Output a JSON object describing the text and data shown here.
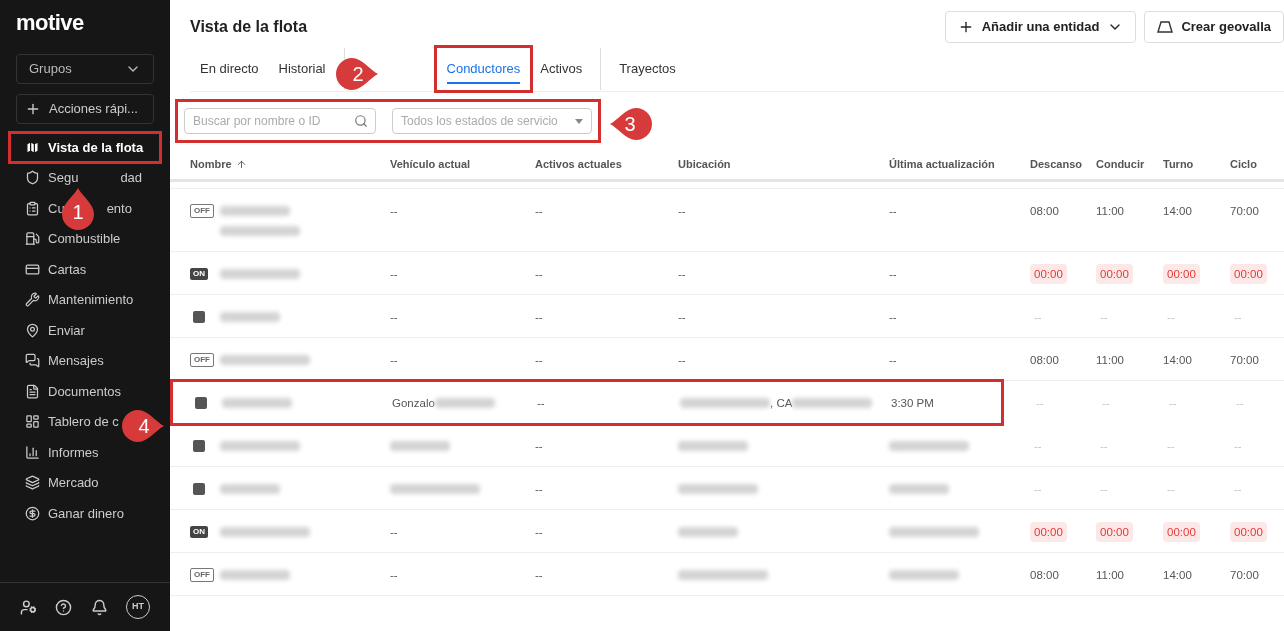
{
  "sidebar": {
    "logo": "motive",
    "groups": {
      "label": "Grupos"
    },
    "quick_actions": {
      "label": "Acciones rápi..."
    },
    "items": [
      {
        "label": "Vista de la flota",
        "selected": true,
        "annotated": true
      },
      {
        "label": "Segu",
        "tail": "dad",
        "selected": false,
        "annotated": false
      },
      {
        "label": "Cu",
        "tail": "ento",
        "selected": false,
        "annotated": false
      },
      {
        "label": "Combustible",
        "selected": false,
        "annotated": false
      },
      {
        "label": "Cartas",
        "selected": false,
        "annotated": false
      },
      {
        "label": "Mantenimiento",
        "selected": false,
        "annotated": false
      },
      {
        "label": "Enviar",
        "selected": false,
        "annotated": false
      },
      {
        "label": "Mensajes",
        "selected": false,
        "annotated": false
      },
      {
        "label": "Documentos",
        "selected": false,
        "annotated": false
      },
      {
        "label": "Tablero de c",
        "selected": false,
        "annotated": false
      },
      {
        "label": "Informes",
        "selected": false,
        "annotated": false
      },
      {
        "label": "Mercado",
        "selected": false,
        "annotated": false
      },
      {
        "label": "Ganar dinero",
        "selected": false,
        "annotated": false
      }
    ],
    "avatar": "HT"
  },
  "header": {
    "title": "Vista de la flota",
    "buttons": [
      {
        "kind": "add",
        "label": "Añadir una entidad"
      },
      {
        "kind": "geofence",
        "label": "Crear geovalla"
      }
    ]
  },
  "tab_groups": [
    [
      {
        "label": "En directo",
        "selected": false,
        "annotated": false
      },
      {
        "label": "Historial",
        "selected": false,
        "annotated": false
      }
    ],
    [
      {
        "label": "Conductores",
        "selected": true,
        "annotated": true
      },
      {
        "label": "Activos",
        "selected": false,
        "annotated": false
      }
    ],
    [
      {
        "label": "Trayectos",
        "selected": false,
        "annotated": false
      }
    ]
  ],
  "filters": {
    "annotated": true,
    "search": {
      "placeholder": "Buscar por nombre o ID"
    },
    "status": {
      "placeholder": "Todos los estados de servicio"
    }
  },
  "table": {
    "columns": [
      {
        "label": "Nombre",
        "sorted": true
      },
      {
        "label": "Vehículo actual",
        "sorted": false
      },
      {
        "label": "Activos actuales",
        "sorted": false
      },
      {
        "label": "Ubicación",
        "sorted": false
      },
      {
        "label": "Última actualización",
        "sorted": false
      },
      {
        "label": "Descanso",
        "sorted": false
      },
      {
        "label": "Conducir",
        "sorted": false
      },
      {
        "label": "Turno",
        "sorted": false
      },
      {
        "label": "Ciclo",
        "sorted": false
      }
    ],
    "rows": [
      {
        "annotated": false,
        "status": {
          "kind": "outline",
          "text": "OFF"
        },
        "cells": [
          [
            {
              "kind": "blur"
            },
            {
              "kind": "blur"
            }
          ],
          [
            {
              "kind": "text",
              "text": "--"
            }
          ],
          [
            {
              "kind": "text",
              "text": "--"
            }
          ],
          [
            {
              "kind": "text",
              "text": "--"
            }
          ],
          [
            {
              "kind": "text",
              "text": "--"
            }
          ],
          [
            {
              "kind": "text",
              "text": "08:00"
            }
          ],
          [
            {
              "kind": "text",
              "text": "11:00"
            }
          ],
          [
            {
              "kind": "text",
              "text": "14:00"
            }
          ],
          [
            {
              "kind": "text",
              "text": "70:00"
            }
          ]
        ]
      },
      {
        "annotated": false,
        "status": {
          "kind": "filled",
          "text": "ON"
        },
        "cells": [
          [
            {
              "kind": "blur"
            }
          ],
          [
            {
              "kind": "text",
              "text": "--"
            }
          ],
          [
            {
              "kind": "text",
              "text": "--"
            }
          ],
          [
            {
              "kind": "text",
              "text": "--"
            }
          ],
          [
            {
              "kind": "text",
              "text": "--"
            }
          ],
          [
            {
              "kind": "alert",
              "text": "00:00"
            }
          ],
          [
            {
              "kind": "alert",
              "text": "00:00"
            }
          ],
          [
            {
              "kind": "alert",
              "text": "00:00"
            }
          ],
          [
            {
              "kind": "alert",
              "text": "00:00"
            }
          ]
        ]
      },
      {
        "annotated": false,
        "status": {
          "kind": "square"
        },
        "cells": [
          [
            {
              "kind": "blur"
            }
          ],
          [
            {
              "kind": "text",
              "text": "--"
            }
          ],
          [
            {
              "kind": "text",
              "text": "--"
            }
          ],
          [
            {
              "kind": "text",
              "text": "--"
            }
          ],
          [
            {
              "kind": "text",
              "text": "--"
            }
          ],
          [
            {
              "kind": "muted",
              "text": "--"
            }
          ],
          [
            {
              "kind": "muted",
              "text": "--"
            }
          ],
          [
            {
              "kind": "muted",
              "text": "--"
            }
          ],
          [
            {
              "kind": "muted",
              "text": "--"
            }
          ]
        ]
      },
      {
        "annotated": false,
        "status": {
          "kind": "outline",
          "text": "OFF"
        },
        "cells": [
          [
            {
              "kind": "blur"
            }
          ],
          [
            {
              "kind": "text",
              "text": "--"
            }
          ],
          [
            {
              "kind": "text",
              "text": "--"
            }
          ],
          [
            {
              "kind": "text",
              "text": "--"
            }
          ],
          [
            {
              "kind": "text",
              "text": "--"
            }
          ],
          [
            {
              "kind": "text",
              "text": "08:00"
            }
          ],
          [
            {
              "kind": "text",
              "text": "11:00"
            }
          ],
          [
            {
              "kind": "text",
              "text": "14:00"
            }
          ],
          [
            {
              "kind": "text",
              "text": "70:00"
            }
          ]
        ]
      },
      {
        "annotated": true,
        "status": {
          "kind": "square"
        },
        "cells": [
          [
            {
              "kind": "blur"
            }
          ],
          [
            {
              "kind": "text",
              "text": "Gonzalo"
            },
            {
              "kind": "blur"
            }
          ],
          [
            {
              "kind": "text",
              "text": "--"
            }
          ],
          [
            {
              "kind": "blur"
            },
            {
              "kind": "text",
              "text": ", CA"
            },
            {
              "kind": "blur"
            }
          ],
          [
            {
              "kind": "text",
              "text": "3:30 PM"
            }
          ],
          [
            {
              "kind": "muted",
              "text": "--"
            }
          ],
          [
            {
              "kind": "muted",
              "text": "--"
            }
          ],
          [
            {
              "kind": "muted",
              "text": "--"
            }
          ],
          [
            {
              "kind": "muted",
              "text": "--"
            }
          ]
        ]
      },
      {
        "annotated": false,
        "status": {
          "kind": "square"
        },
        "cells": [
          [
            {
              "kind": "blur"
            }
          ],
          [
            {
              "kind": "blur"
            }
          ],
          [
            {
              "kind": "text",
              "text": "--"
            }
          ],
          [
            {
              "kind": "blur"
            }
          ],
          [
            {
              "kind": "blur"
            }
          ],
          [
            {
              "kind": "muted",
              "text": "--"
            }
          ],
          [
            {
              "kind": "muted",
              "text": "--"
            }
          ],
          [
            {
              "kind": "muted",
              "text": "--"
            }
          ],
          [
            {
              "kind": "muted",
              "text": "--"
            }
          ]
        ]
      },
      {
        "annotated": false,
        "status": {
          "kind": "square"
        },
        "cells": [
          [
            {
              "kind": "blur"
            }
          ],
          [
            {
              "kind": "blur"
            }
          ],
          [
            {
              "kind": "text",
              "text": "--"
            }
          ],
          [
            {
              "kind": "blur"
            }
          ],
          [
            {
              "kind": "blur"
            }
          ],
          [
            {
              "kind": "muted",
              "text": "--"
            }
          ],
          [
            {
              "kind": "muted",
              "text": "--"
            }
          ],
          [
            {
              "kind": "muted",
              "text": "--"
            }
          ],
          [
            {
              "kind": "muted",
              "text": "--"
            }
          ]
        ]
      },
      {
        "annotated": false,
        "status": {
          "kind": "filled",
          "text": "ON"
        },
        "cells": [
          [
            {
              "kind": "blur"
            }
          ],
          [
            {
              "kind": "text",
              "text": "--"
            }
          ],
          [
            {
              "kind": "text",
              "text": "--"
            }
          ],
          [
            {
              "kind": "blur"
            }
          ],
          [
            {
              "kind": "blur"
            }
          ],
          [
            {
              "kind": "alert",
              "text": "00:00"
            }
          ],
          [
            {
              "kind": "alert",
              "text": "00:00"
            }
          ],
          [
            {
              "kind": "alert",
              "text": "00:00"
            }
          ],
          [
            {
              "kind": "alert",
              "text": "00:00"
            }
          ]
        ]
      },
      {
        "annotated": false,
        "status": {
          "kind": "outline",
          "text": "OFF"
        },
        "cells": [
          [
            {
              "kind": "blur"
            }
          ],
          [
            {
              "kind": "text",
              "text": "--"
            }
          ],
          [
            {
              "kind": "text",
              "text": "--"
            }
          ],
          [
            {
              "kind": "blur"
            }
          ],
          [
            {
              "kind": "blur"
            }
          ],
          [
            {
              "kind": "text",
              "text": "08:00"
            }
          ],
          [
            {
              "kind": "text",
              "text": "11:00"
            }
          ],
          [
            {
              "kind": "text",
              "text": "14:00"
            }
          ],
          [
            {
              "kind": "text",
              "text": "70:00"
            }
          ]
        ]
      }
    ]
  },
  "callouts": [
    {
      "text": "1"
    },
    {
      "text": "2"
    },
    {
      "text": "3"
    },
    {
      "text": "4"
    }
  ]
}
